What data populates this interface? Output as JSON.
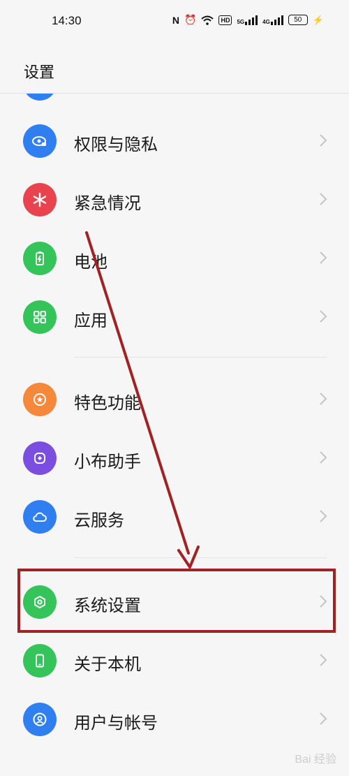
{
  "status_bar": {
    "time": "14:30",
    "icons": [
      "nfc-icon",
      "alarm-icon",
      "wifi-icon",
      "hd-icon",
      "signal-5g-icon",
      "signal-4g-icon",
      "battery-icon",
      "charging-icon"
    ],
    "hd_label": "HD",
    "net1_label": "5G",
    "net2_label": "4G",
    "battery_level": "50"
  },
  "header": {
    "title": "设置"
  },
  "settings": {
    "items": [
      {
        "label": "权限与隐私",
        "icon": "eye-lock-icon",
        "color": "#2f7ff0"
      },
      {
        "label": "紧急情况",
        "icon": "asterisk-icon",
        "color": "#e8434f"
      },
      {
        "label": "电池",
        "icon": "battery-icon",
        "color": "#34c459"
      },
      {
        "label": "应用",
        "icon": "apps-grid-icon",
        "color": "#34c459"
      },
      {
        "label": "特色功能",
        "icon": "star-icon",
        "color": "#f5883a"
      },
      {
        "label": "小布助手",
        "icon": "assistant-icon",
        "color": "#7a4fe0"
      },
      {
        "label": "云服务",
        "icon": "cloud-icon",
        "color": "#2f7ff0"
      },
      {
        "label": "系统设置",
        "icon": "hexagon-gear-icon",
        "color": "#34c459"
      },
      {
        "label": "关于本机",
        "icon": "phone-icon",
        "color": "#34c459"
      },
      {
        "label": "用户与帐号",
        "icon": "user-icon",
        "color": "#2f7ff0"
      }
    ]
  },
  "annotation": {
    "highlight_color": "#a02222"
  },
  "watermark": {
    "text": "Bai 经验"
  }
}
